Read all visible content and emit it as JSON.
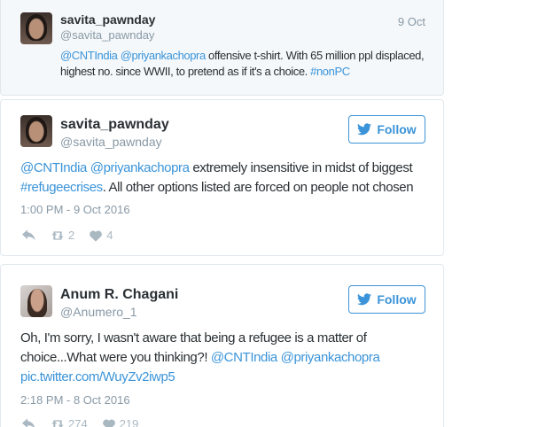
{
  "reply": {
    "display_name": "savita_pawnday",
    "handle": "@savita_pawnday",
    "date": "9 Oct",
    "text_parts": {
      "mention1": "@CNTIndia",
      "mention2": "@priyankachopra",
      "body": " offensive t-shirt. With 65 million ppl displaced, highest no. since WWII, to pretend as if it's a choice. ",
      "hashtag": "#nonPC"
    }
  },
  "tweets": [
    {
      "display_name": "savita_pawnday",
      "handle": "@savita_pawnday",
      "follow_label": "Follow",
      "text_parts": {
        "mention1": "@CNTIndia",
        "mention2": "@priyankachopra",
        "body1": " extremely insensitive in midst of biggest ",
        "hashtag": "#refugeecrises",
        "body2": ". All other options listed are forced on people not chosen"
      },
      "timestamp": "1:00 PM - 9 Oct 2016",
      "retweets": "2",
      "likes": "4"
    },
    {
      "display_name": "Anum R. Chagani",
      "handle": "@Anumero_1",
      "follow_label": "Follow",
      "text_parts": {
        "body1": "Oh, I'm sorry, I wasn't aware that being a refugee is a matter of choice...What were you thinking?! ",
        "mention1": "@CNTIndia",
        "mention2": "@priyankachopra",
        "pic_link": "pic.twitter.com/WuyZv2iwp5"
      },
      "timestamp": "2:18 PM - 8 Oct 2016",
      "retweets": "274",
      "likes": "219"
    }
  ],
  "icons": {
    "follow": "twitter-bird-icon",
    "reply": "reply-arrow-icon",
    "retweet": "retweet-icon",
    "like": "heart-icon"
  },
  "colors": {
    "link": "#3b94d9",
    "muted": "#8899a6",
    "text": "#292f33",
    "reply_bg": "#f5f8fa",
    "border": "#e1e8ed"
  }
}
